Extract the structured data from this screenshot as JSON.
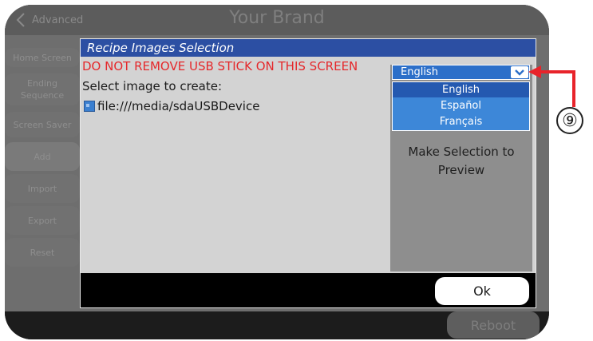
{
  "header": {
    "back_label": "Advanced",
    "brand": "Your Brand"
  },
  "sidebar": {
    "items": [
      {
        "label": "Home Screen"
      },
      {
        "label": "Ending Sequence"
      },
      {
        "label": "Screen Saver"
      },
      {
        "label": "Add"
      },
      {
        "label": "Import"
      },
      {
        "label": "Export"
      },
      {
        "label": "Reset"
      }
    ]
  },
  "footer": {
    "reboot_label": "Reboot"
  },
  "dialog": {
    "title": "Recipe Images Selection",
    "warning": "DO NOT REMOVE USB STICK ON THIS SCREEN",
    "prompt": "Select image to create:",
    "folder_path": "file:///media/sdaUSBDevice",
    "preview_text_line1": "Make Selection to",
    "preview_text_line2": "Preview",
    "ok_label": "Ok",
    "language_select": {
      "value": "English",
      "options": [
        "English",
        "Español",
        "Français"
      ]
    }
  },
  "callout": {
    "number": "⑨"
  },
  "colors": {
    "title_bar": "#2c4fa3",
    "warning": "#e5282b",
    "select_blue": "#2c6fc9",
    "callout_arrow": "#e8232a"
  }
}
